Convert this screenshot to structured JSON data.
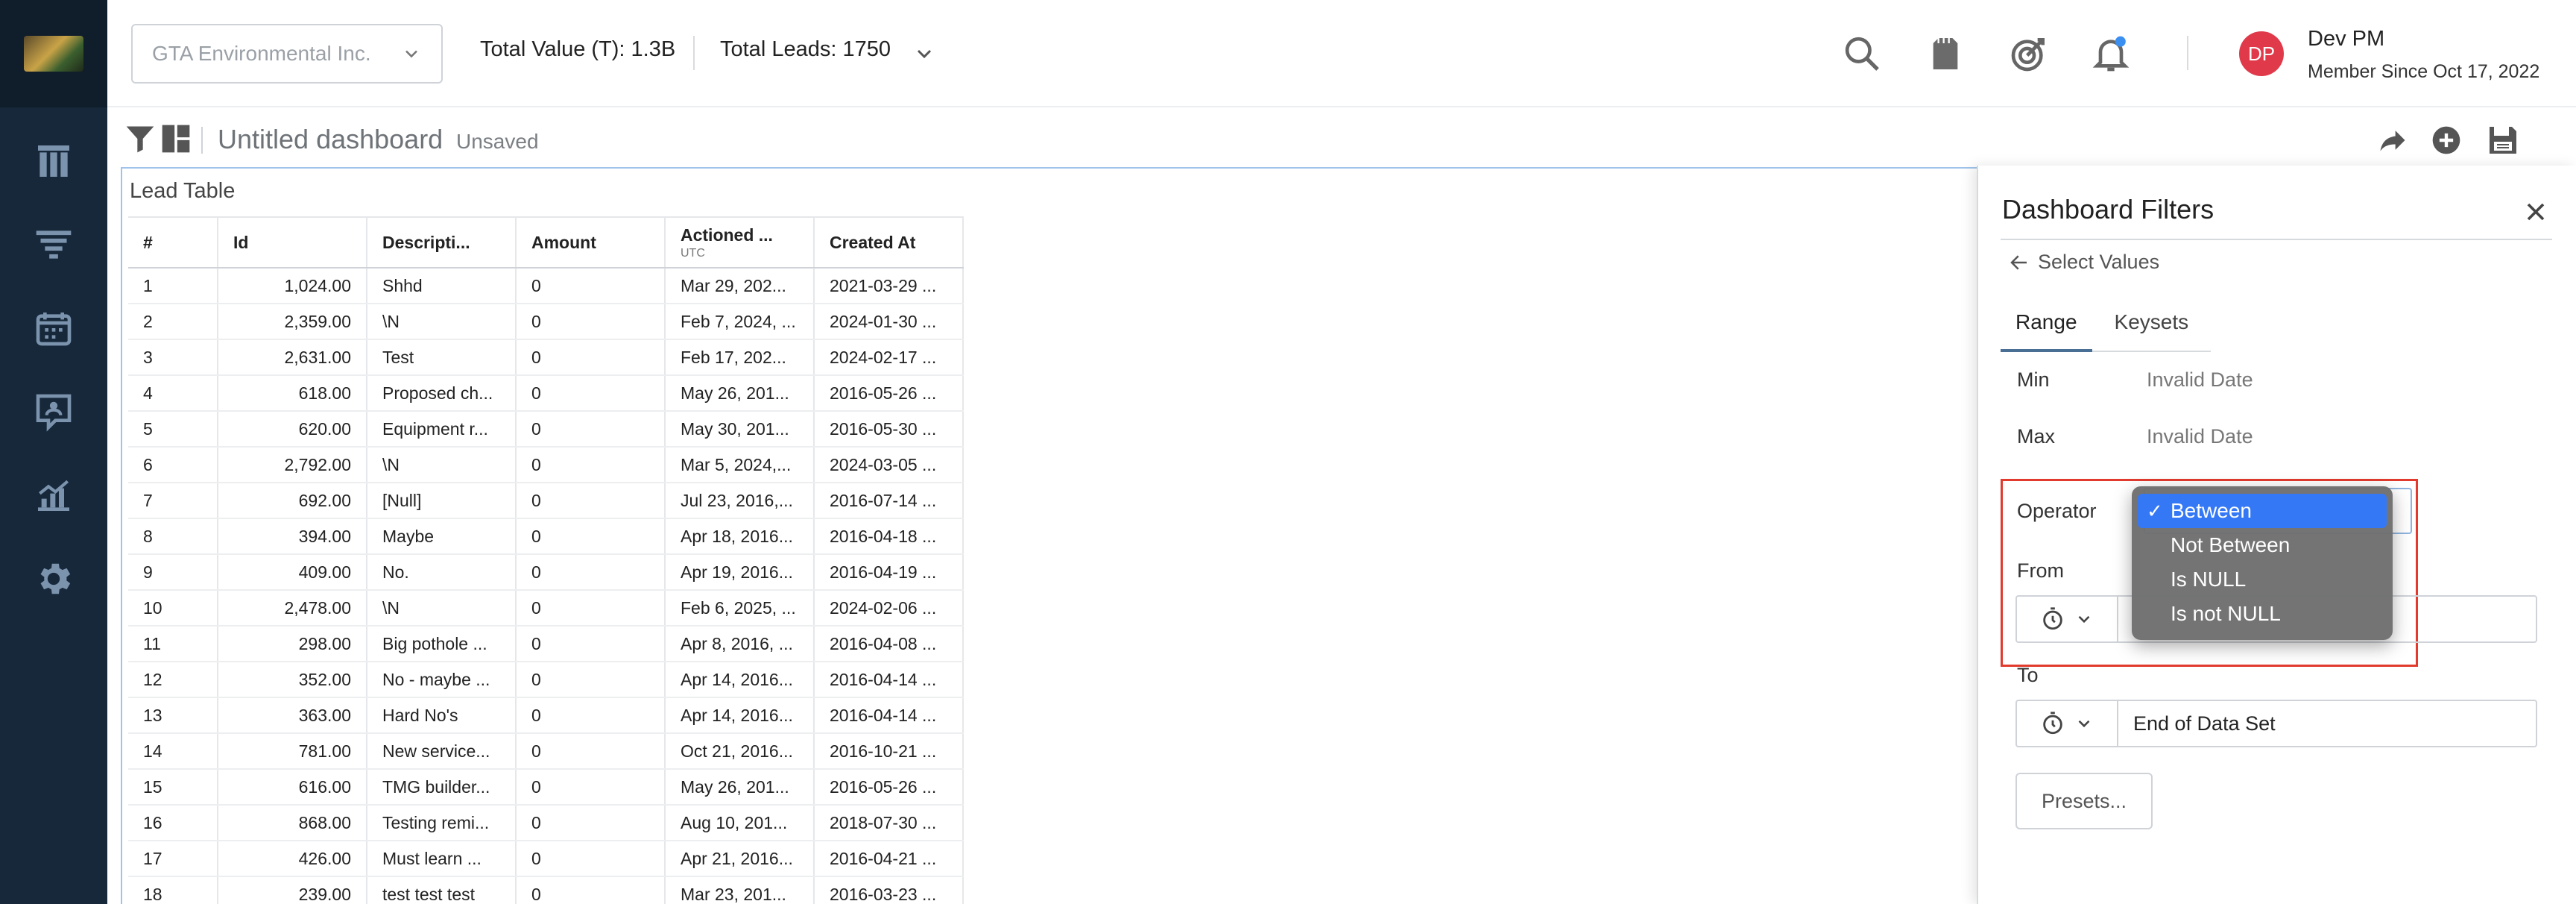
{
  "header": {
    "company": "GTA Environmental Inc.",
    "total_value_label": "Total Value (T):",
    "total_value": "1.3B",
    "total_leads_label": "Total Leads:",
    "total_leads": "1750",
    "user_initials": "DP",
    "user_name": "Dev PM",
    "member_since": "Member Since Oct 17, 2022",
    "avatar_color": "#e0394a"
  },
  "dashboard": {
    "title": "Untitled dashboard",
    "status": "Unsaved"
  },
  "table": {
    "title": "Lead Table",
    "columns": [
      "#",
      "Id",
      "Descripti...",
      "Amount",
      "Actioned ...",
      "Created At"
    ],
    "actioned_sub": "UTC",
    "rows": [
      [
        "1",
        "1,024.00",
        "Shhd",
        "0",
        "Mar 29, 202...",
        "2021-03-29 ..."
      ],
      [
        "2",
        "2,359.00",
        "\\N",
        "0",
        "Feb 7, 2024, ...",
        "2024-01-30 ..."
      ],
      [
        "3",
        "2,631.00",
        "Test",
        "0",
        "Feb 17, 202...",
        "2024-02-17 ..."
      ],
      [
        "4",
        "618.00",
        "Proposed ch...",
        "0",
        "May 26, 201...",
        "2016-05-26 ..."
      ],
      [
        "5",
        "620.00",
        "Equipment r...",
        "0",
        "May 30, 201...",
        "2016-05-30 ..."
      ],
      [
        "6",
        "2,792.00",
        "\\N",
        "0",
        "Mar 5, 2024,...",
        "2024-03-05 ..."
      ],
      [
        "7",
        "692.00",
        "[Null]",
        "0",
        "Jul 23, 2016,...",
        "2016-07-14 ..."
      ],
      [
        "8",
        "394.00",
        "Maybe",
        "0",
        "Apr 18, 2016...",
        "2016-04-18 ..."
      ],
      [
        "9",
        "409.00",
        "No.",
        "0",
        "Apr 19, 2016...",
        "2016-04-19 ..."
      ],
      [
        "10",
        "2,478.00",
        "\\N",
        "0",
        "Feb 6, 2025, ...",
        "2024-02-06 ..."
      ],
      [
        "11",
        "298.00",
        "Big pothole ...",
        "0",
        "Apr 8, 2016, ...",
        "2016-04-08 ..."
      ],
      [
        "12",
        "352.00",
        "No - maybe ...",
        "0",
        "Apr 14, 2016...",
        "2016-04-14 ..."
      ],
      [
        "13",
        "363.00",
        "Hard No's",
        "0",
        "Apr 14, 2016...",
        "2016-04-14 ..."
      ],
      [
        "14",
        "781.00",
        "New service...",
        "0",
        "Oct 21, 2016...",
        "2016-10-21 ..."
      ],
      [
        "15",
        "616.00",
        "TMG builder...",
        "0",
        "May 26, 201...",
        "2016-05-26 ..."
      ],
      [
        "16",
        "868.00",
        "Testing remi...",
        "0",
        "Aug 10, 201...",
        "2018-07-30 ..."
      ],
      [
        "17",
        "426.00",
        "Must learn ...",
        "0",
        "Apr 21, 2016...",
        "2016-04-21 ..."
      ],
      [
        "18",
        "239.00",
        "test test test",
        "0",
        "Mar 23, 201...",
        "2016-03-23 ..."
      ]
    ]
  },
  "filters": {
    "title": "Dashboard Filters",
    "back_label": "Select Values",
    "tabs": [
      "Range",
      "Keysets"
    ],
    "min_label": "Min",
    "min_value": "Invalid Date",
    "max_label": "Max",
    "max_value": "Invalid Date",
    "operator_label": "Operator",
    "from_label": "From",
    "to_label": "To",
    "to_value": "End of Data Set",
    "presets_label": "Presets...",
    "highlight_color": "#e23b2e"
  },
  "operator_dropdown": {
    "options": [
      "Between",
      "Not Between",
      "Is NULL",
      "Is not NULL"
    ],
    "selected": "Between",
    "check": "✓"
  }
}
